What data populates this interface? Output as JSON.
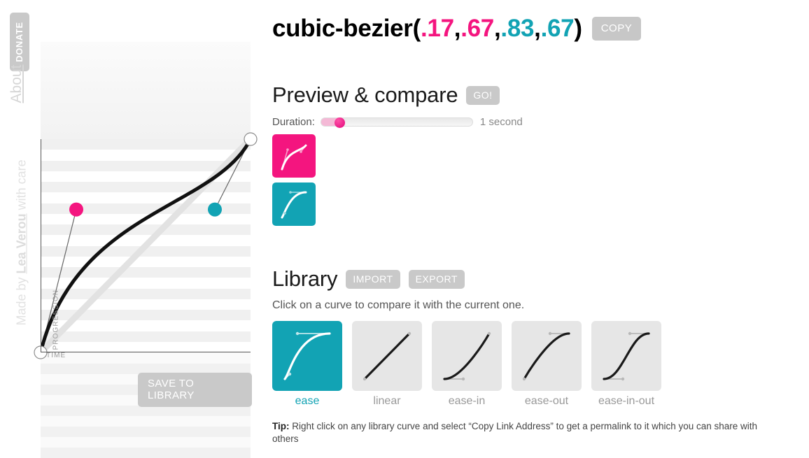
{
  "sidebar": {
    "donate_label": "DONATE",
    "about_label": "About",
    "credit_prefix": "Made by ",
    "credit_author": "Lea Verou",
    "credit_suffix": " with care"
  },
  "curve_editor": {
    "y_axis_label": "PROGRESSION",
    "x_axis_label": "TIME",
    "save_label": "SAVE TO LIBRARY",
    "control_points": {
      "p1": {
        "x": 0.17,
        "y": 0.67,
        "color": "#f4157f"
      },
      "p2": {
        "x": 0.83,
        "y": 0.67,
        "color": "#12a3b4"
      }
    },
    "endpoints": {
      "start": {
        "x": 0,
        "y": 0
      },
      "end": {
        "x": 1,
        "y": 1
      }
    },
    "reference_line": "linear",
    "grid_bands": 10
  },
  "header": {
    "function_name": "cubic-bezier(",
    "p1x": ".17",
    "sep1": ",",
    "p1y": ".67",
    "sep2": ",",
    "p2x": ".83",
    "sep3": ",",
    "p2y": ".67",
    "close_paren": ")",
    "copy_label": "COPY"
  },
  "preview": {
    "heading": "Preview & compare",
    "go_label": "GO!",
    "duration_label": "Duration:",
    "duration_value": "1 second",
    "duration_percent": 12,
    "swatches": [
      {
        "name": "current",
        "color": "#f4157f",
        "curve": [
          0.17,
          0.67,
          0.83,
          0.67
        ]
      },
      {
        "name": "compare",
        "color": "#12a3b4",
        "curve": [
          0.25,
          0.1,
          0.25,
          1
        ]
      }
    ]
  },
  "library": {
    "heading": "Library",
    "import_label": "IMPORT",
    "export_label": "EXPORT",
    "hint": "Click on a curve to compare it with the current one.",
    "items": [
      {
        "label": "ease",
        "curve": [
          0.25,
          0.1,
          0.25,
          1
        ],
        "selected": true
      },
      {
        "label": "linear",
        "curve": [
          0,
          0,
          1,
          1
        ],
        "selected": false
      },
      {
        "label": "ease-in",
        "curve": [
          0.42,
          0,
          1,
          1
        ],
        "selected": false
      },
      {
        "label": "ease-out",
        "curve": [
          0,
          0,
          0.58,
          1
        ],
        "selected": false
      },
      {
        "label": "ease-in-out",
        "curve": [
          0.42,
          0,
          0.58,
          1
        ],
        "selected": false
      }
    ]
  },
  "tip": {
    "label": "Tip:",
    "text": " Right click on any library curve and select “Copy Link Address” to get a permalink to it which you can share with others"
  },
  "colors": {
    "pink": "#f4157f",
    "teal": "#12a3b4",
    "button_gray": "#c9c9c9",
    "thumb_gray": "#e6e6e6"
  }
}
